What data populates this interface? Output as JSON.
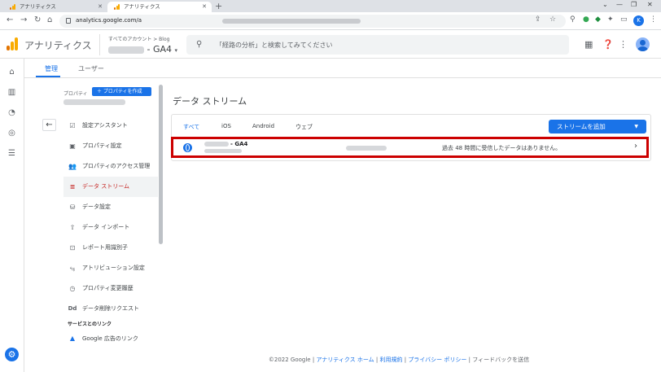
{
  "browser": {
    "tabs": [
      {
        "title": "アナリティクス",
        "active": false
      },
      {
        "title": "アナリティクス",
        "active": true
      }
    ],
    "url": "analytics.google.com/a",
    "profile_initial": "K"
  },
  "header": {
    "app_name": "アナリティクス",
    "breadcrumb": "すべてのアカウント > Blog",
    "property_suffix": "- GA4",
    "search_placeholder": "「経路の分析」と検索してみてください"
  },
  "admin_tabs": [
    {
      "label": "管理",
      "active": true
    },
    {
      "label": "ユーザー",
      "active": false
    }
  ],
  "property_column": {
    "label": "プロパティ",
    "create_button": "プロパティを作成",
    "menu": [
      {
        "label": "設定アシスタント",
        "icon": "checkbox-icon",
        "active": false
      },
      {
        "label": "プロパティ設定",
        "icon": "property-settings-icon",
        "active": false
      },
      {
        "label": "プロパティのアクセス管理",
        "icon": "people-icon",
        "active": false
      },
      {
        "label": "データ ストリーム",
        "icon": "data-stream-icon",
        "active": true
      },
      {
        "label": "データ設定",
        "icon": "database-icon",
        "active": false
      },
      {
        "label": "データ インポート",
        "icon": "upload-icon",
        "active": false
      },
      {
        "label": "レポート用識別子",
        "icon": "identity-icon",
        "active": false
      },
      {
        "label": "アトリビューション設定",
        "icon": "attribution-icon",
        "active": false
      },
      {
        "label": "プロパティ変更履歴",
        "icon": "history-icon",
        "active": false
      },
      {
        "label": "データ削除リクエスト",
        "icon": "dd-icon",
        "active": false
      }
    ],
    "links_section": "サービスとのリンク",
    "links": [
      {
        "label": "Google 広告のリンク",
        "icon": "google-ads-icon"
      }
    ]
  },
  "data_streams": {
    "title": "データ ストリーム",
    "filters": [
      {
        "label": "すべて",
        "active": true
      },
      {
        "label": "iOS",
        "active": false
      },
      {
        "label": "Android",
        "active": false
      },
      {
        "label": "ウェブ",
        "active": false
      }
    ],
    "add_button": "ストリームを追加",
    "stream": {
      "name_suffix": "- GA4",
      "status": "過去 48 時間に受信したデータはありません。"
    }
  },
  "footer": {
    "copyright": "©2022 Google |",
    "links": [
      "アナリティクス ホーム",
      "利用規約",
      "プライバシー ポリシー"
    ],
    "feedback": "フィードバックを送信"
  },
  "colors": {
    "accent": "#1a73e8",
    "highlight_border": "#cc0000",
    "active_menu": "#c5221f"
  }
}
